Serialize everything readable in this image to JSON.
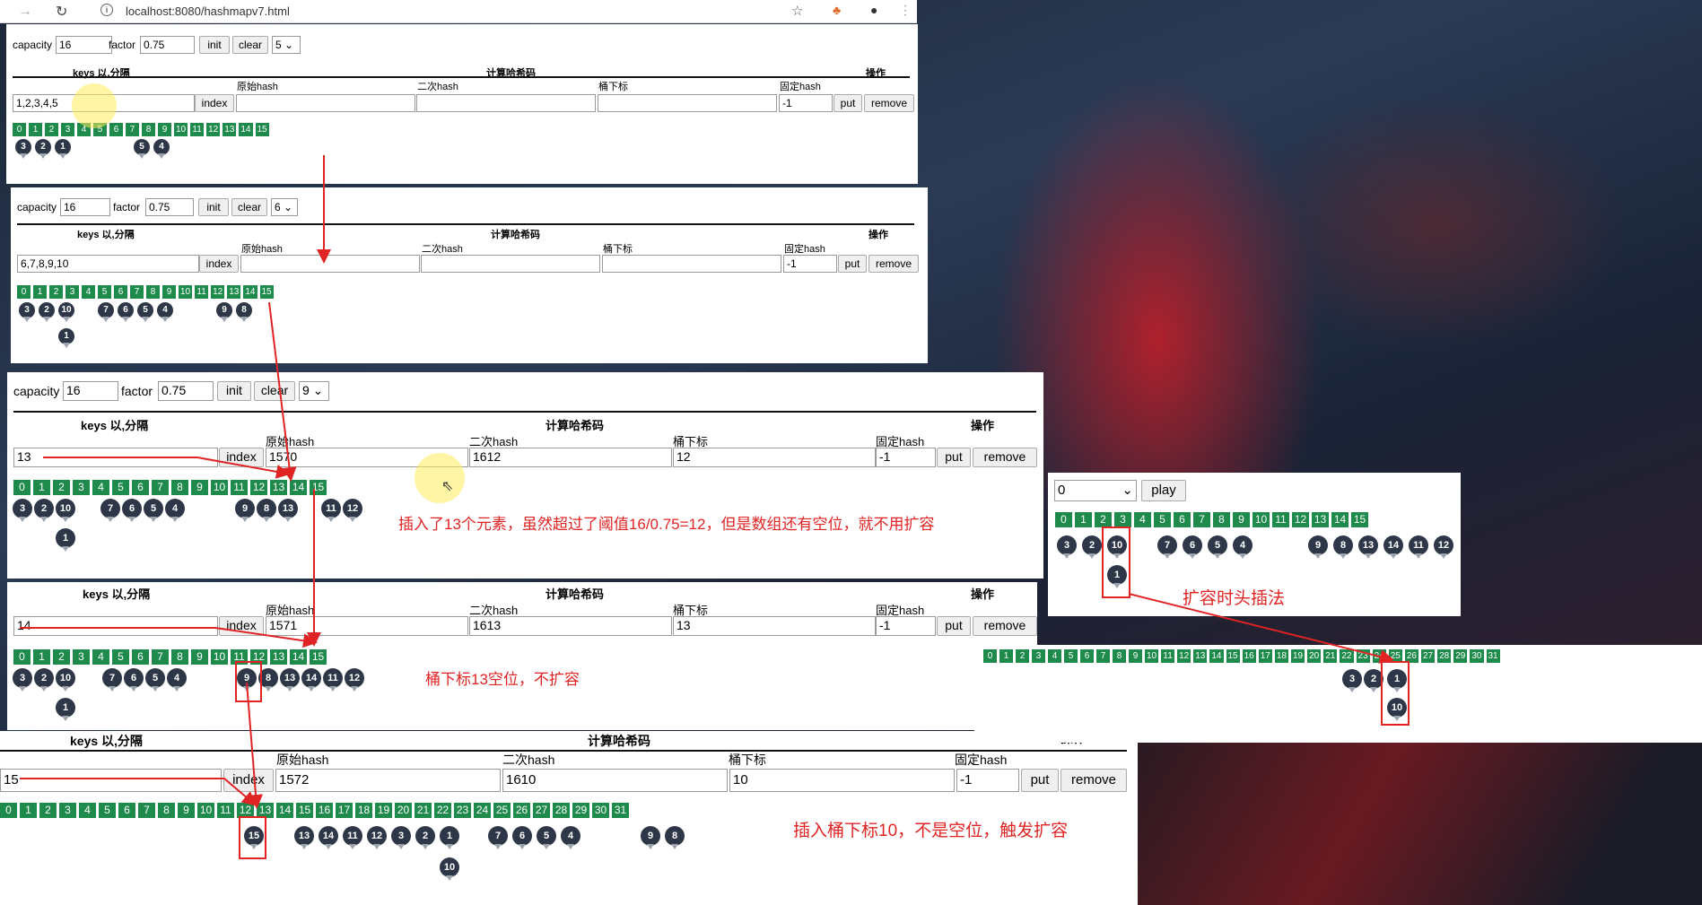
{
  "browser": {
    "url": "localhost:8080/hashmapv7.html",
    "back_icon": "arrow-left-icon",
    "reload_icon": "reload-icon",
    "info_icon": "info-icon"
  },
  "labels": {
    "capacity": "capacity",
    "factor": "factor",
    "init": "init",
    "clear": "clear",
    "keys": "keys 以,分隔",
    "compute": "计算哈希码",
    "original_hash": "原始hash",
    "secondary_hash": "二次hash",
    "bucket_index": "桶下标",
    "fixed_hash": "固定hash",
    "ops": "操作",
    "index": "index",
    "put": "put",
    "remove": "remove",
    "play": "play"
  },
  "panel1": {
    "capacity": "16",
    "factor": "0.75",
    "select": "5",
    "keys": "1,2,3,4,5",
    "original_hash": "",
    "secondary_hash": "",
    "bucket_index": "",
    "fixed_hash": "-1"
  },
  "panel2": {
    "capacity": "16",
    "factor": "0.75",
    "select": "6",
    "keys": "6,7,8,9,10",
    "original_hash": "",
    "secondary_hash": "",
    "bucket_index": "",
    "fixed_hash": "-1"
  },
  "panel3": {
    "capacity": "16",
    "factor": "0.75",
    "select": "9",
    "keys": "13",
    "original_hash": "1570",
    "secondary_hash": "1612",
    "bucket_index": "12",
    "fixed_hash": "-1"
  },
  "panel4": {
    "keys": "14",
    "original_hash": "1571",
    "secondary_hash": "1613",
    "bucket_index": "13",
    "fixed_hash": "-1"
  },
  "panel5": {
    "keys": "15",
    "original_hash": "1572",
    "secondary_hash": "1610",
    "bucket_index": "10",
    "fixed_hash": "-1",
    "ops_label": "操作"
  },
  "panel6": {
    "select": "0"
  },
  "buckets16": [
    "0",
    "1",
    "2",
    "3",
    "4",
    "5",
    "6",
    "7",
    "8",
    "9",
    "10",
    "11",
    "12",
    "13",
    "14",
    "15"
  ],
  "buckets32": [
    "0",
    "1",
    "2",
    "3",
    "4",
    "5",
    "6",
    "7",
    "8",
    "9",
    "10",
    "11",
    "12",
    "13",
    "14",
    "15",
    "16",
    "17",
    "18",
    "19",
    "20",
    "21",
    "22",
    "23",
    "24",
    "25",
    "26",
    "27",
    "28",
    "29",
    "30",
    "31"
  ],
  "annotations": {
    "note3": "插入了13个元素，虽然超过了阈值16/0.75=12，但是数组还有空位，就不用扩容",
    "note4": "桶下标13空位，不扩容",
    "note5": "插入桶下标10，不是空位，触发扩容",
    "note6": "扩容时头插法"
  }
}
